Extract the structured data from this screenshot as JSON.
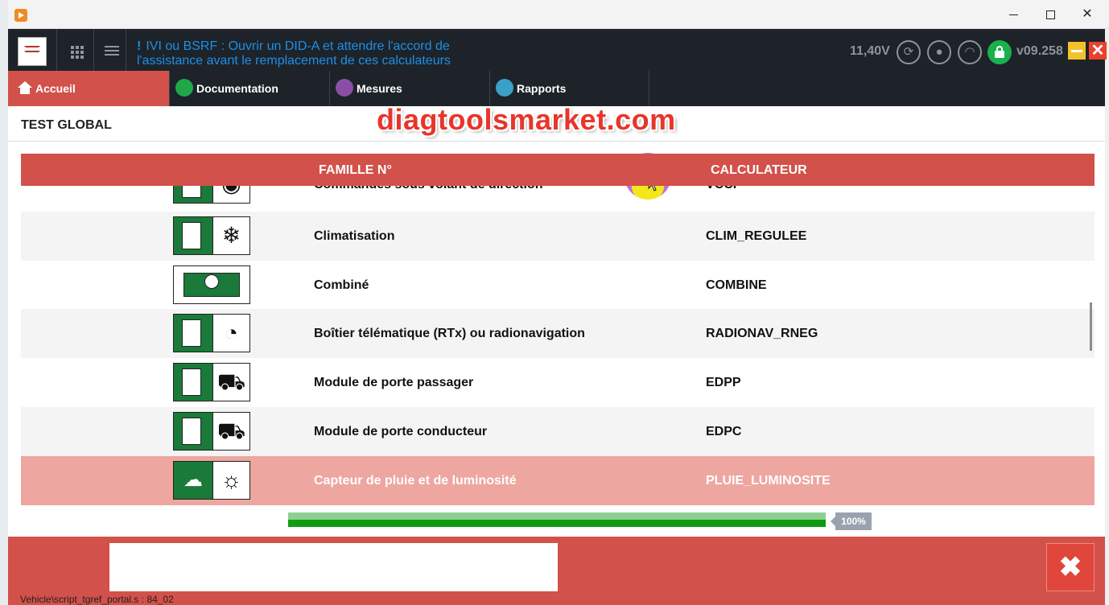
{
  "header": {
    "alert_mark": "!",
    "alert_text_line1": "IVI ou BSRF : Ouvrir un DID-A et attendre l'accord de",
    "alert_text_line2": "l'assistance avant le remplacement de ces calculateurs",
    "voltage": "11,40V",
    "version": "v09.258",
    "close_glyph": "✕"
  },
  "nav": {
    "tabs": [
      {
        "label": "Accueil",
        "icon": "home-icon"
      },
      {
        "label": "Documentation",
        "icon": "folder-icon"
      },
      {
        "label": "Mesures",
        "icon": "pulse-icon"
      },
      {
        "label": "Rapports",
        "icon": "report-icon"
      }
    ]
  },
  "page": {
    "title": "TEST GLOBAL",
    "watermark": "diagtoolsmarket.com"
  },
  "table": {
    "headers": {
      "famille": "FAMILLE N°",
      "calculateur": "CALCULATEUR"
    },
    "rows": [
      {
        "name": "Commandes sous volant de direction",
        "calc": "VCCF",
        "icon": "steering-controls-icon"
      },
      {
        "name": "Climatisation",
        "calc": "CLIM_REGULEE",
        "icon": "snowflake-icon"
      },
      {
        "name": "Combiné",
        "calc": "COMBINE",
        "icon": "instrument-cluster-icon"
      },
      {
        "name": "Boîtier télématique (RTx) ou radionavigation",
        "calc": "RADIONAV_RNEG",
        "icon": "radio-icon"
      },
      {
        "name": "Module de porte passager",
        "calc": "EDPP",
        "icon": "car-door-icon"
      },
      {
        "name": "Module de porte conducteur",
        "calc": "EDPC",
        "icon": "car-door-icon"
      },
      {
        "name": "Capteur de pluie et de luminosité",
        "calc": "PLUIE_LUMINOSITE",
        "icon": "rain-sun-icon",
        "selected": true
      }
    ]
  },
  "progress": {
    "value": 1.0,
    "label": "100%"
  },
  "footer": {
    "path": "Vehicle\\script_tgref_portal.s : 84_02",
    "close_glyph": "✖"
  },
  "colors": {
    "accent": "#d2514a",
    "header_bg": "#1d2329",
    "alert_blue": "#1e8fe6",
    "selected_row": "#eea6a0",
    "progress_green": "#0f9d0f",
    "lock_green": "#19b04e"
  }
}
